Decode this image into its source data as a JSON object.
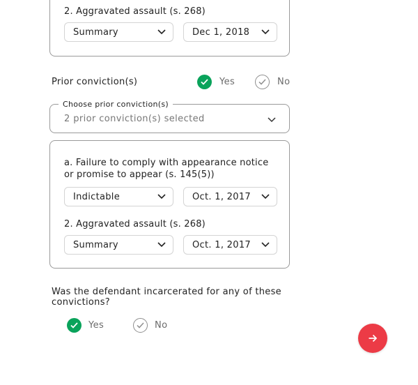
{
  "top_card": {
    "charge": "2. Aggravated assault (s. 268)",
    "type_value": "Summary",
    "date_value": "Dec 1, 2018"
  },
  "prior_convictions": {
    "label": "Prior conviction(s)",
    "yes_label": "Yes",
    "no_label": "No",
    "selected": "yes",
    "select_legend": "Choose prior conviction(s)",
    "select_value": "2 prior conviction(s) selected"
  },
  "prior_card": {
    "items": [
      {
        "charge": "a.  Failure to comply with appearance notice or promise to appear (s. 145(5))",
        "charge_line1": "a.  Failure to comply with appearance notice",
        "charge_line2": "or promise to appear (s. 145(5))",
        "type_value": "Indictable",
        "date_value": "Oct. 1, 2017"
      },
      {
        "charge": "2. Aggravated assault (s. 268)",
        "type_value": "Summary",
        "date_value": "Oct. 1, 2017"
      }
    ]
  },
  "incarcerated": {
    "question": "Was the defendant incarcerated for any of these convictions?",
    "question_line1": "Was the defendant incarcerated for any of these",
    "question_line2": "convictions?",
    "yes_label": "Yes",
    "no_label": "No",
    "selected": "yes"
  },
  "next_button": {
    "icon": "arrow-right-icon"
  },
  "colors": {
    "check_selected": "#0aa35b",
    "next_button": "#ec3b46",
    "border": "#9a9a9a"
  }
}
